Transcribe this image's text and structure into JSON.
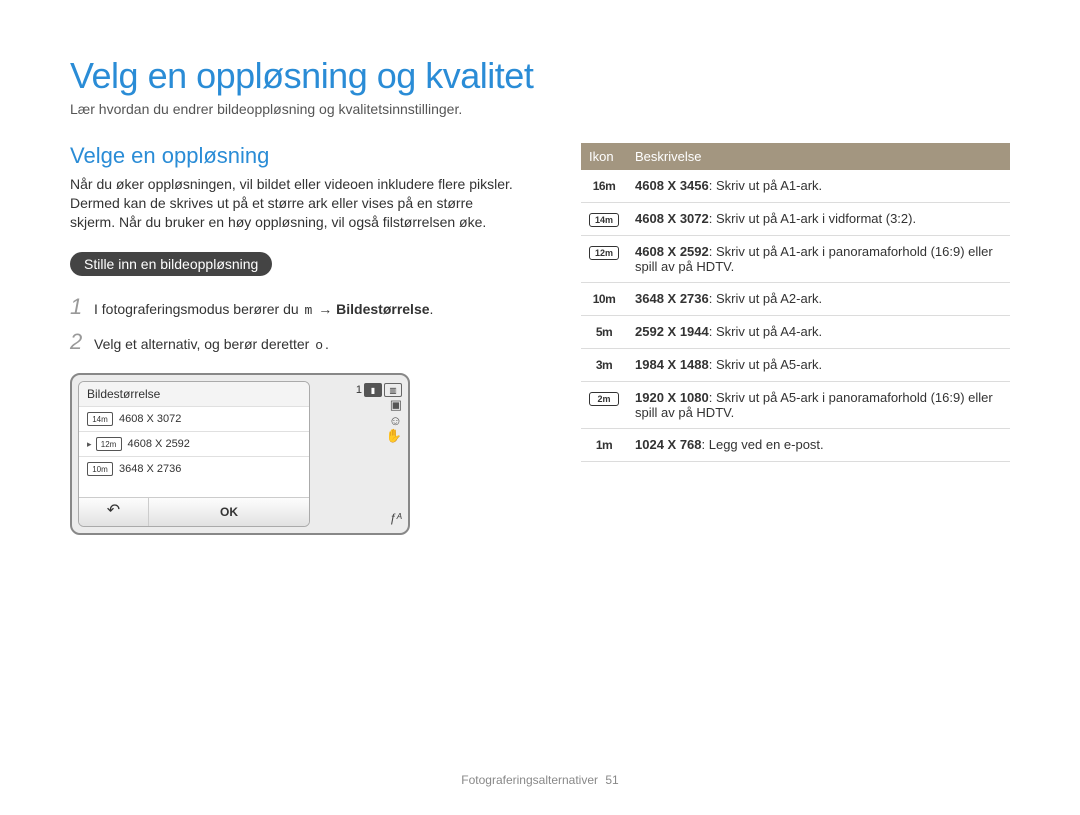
{
  "page": {
    "title": "Velg en oppløsning og kvalitet",
    "subtitle": "Lær hvordan du endrer bildeoppløsning og kvalitetsinnstillinger."
  },
  "left": {
    "section_title": "Velge en oppløsning",
    "intro": "Når du øker oppløsningen, vil bildet eller videoen inkludere flere piksler. Dermed kan de skrives ut på et større ark eller vises på en større skjerm. Når du bruker en høy oppløsning, vil også filstørrelsen øke.",
    "pill": "Stille inn en bildeoppløsning",
    "steps": [
      {
        "num": "1",
        "pre": "I fotograferingsmodus berører du ",
        "icon": "m",
        "mid": " → ",
        "strong": "Bildestørrelse",
        "post": "."
      },
      {
        "num": "2",
        "pre": "Velg et alternativ, og berør deretter ",
        "icon": "o",
        "mid": "",
        "strong": "",
        "post": "."
      }
    ],
    "camera": {
      "menu_title": "Bildestørrelse",
      "items": [
        {
          "icon": "14m",
          "label": "4608 X 3072",
          "selected": false
        },
        {
          "icon": "12m",
          "label": "4608 X 2592",
          "selected": true
        },
        {
          "icon": "10m",
          "label": "3648 X 2736",
          "selected": false
        }
      ],
      "back": "↶",
      "ok": "OK",
      "count": "1",
      "flash": "ƒᴬ"
    }
  },
  "right": {
    "headers": {
      "icon": "Ikon",
      "desc": "Beskrivelse"
    },
    "rows": [
      {
        "icon_text": "16m",
        "boxed": false,
        "res": "4608 X 3456",
        "desc": ": Skriv ut på A1-ark."
      },
      {
        "icon_text": "14m",
        "boxed": true,
        "res": "4608 X 3072",
        "desc": ": Skriv ut på A1-ark i vidformat (3:2)."
      },
      {
        "icon_text": "12m",
        "boxed": true,
        "res": "4608 X 2592",
        "desc": ": Skriv ut på A1-ark i panoramaforhold (16:9) eller spill av på HDTV."
      },
      {
        "icon_text": "10m",
        "boxed": false,
        "res": "3648 X 2736",
        "desc": ": Skriv ut på A2-ark."
      },
      {
        "icon_text": "5m",
        "boxed": false,
        "res": "2592 X 1944",
        "desc": ": Skriv ut på A4-ark."
      },
      {
        "icon_text": "3m",
        "boxed": false,
        "res": "1984 X 1488",
        "desc": ": Skriv ut på A5-ark."
      },
      {
        "icon_text": "2m",
        "boxed": true,
        "res": "1920 X 1080",
        "desc": ": Skriv ut på A5-ark i panoramaforhold (16:9) eller spill av på HDTV."
      },
      {
        "icon_text": "1m",
        "boxed": false,
        "res": "1024 X 768",
        "desc": ": Legg ved en e-post."
      }
    ]
  },
  "footer": {
    "section": "Fotograferingsalternativer",
    "page_num": "51"
  }
}
